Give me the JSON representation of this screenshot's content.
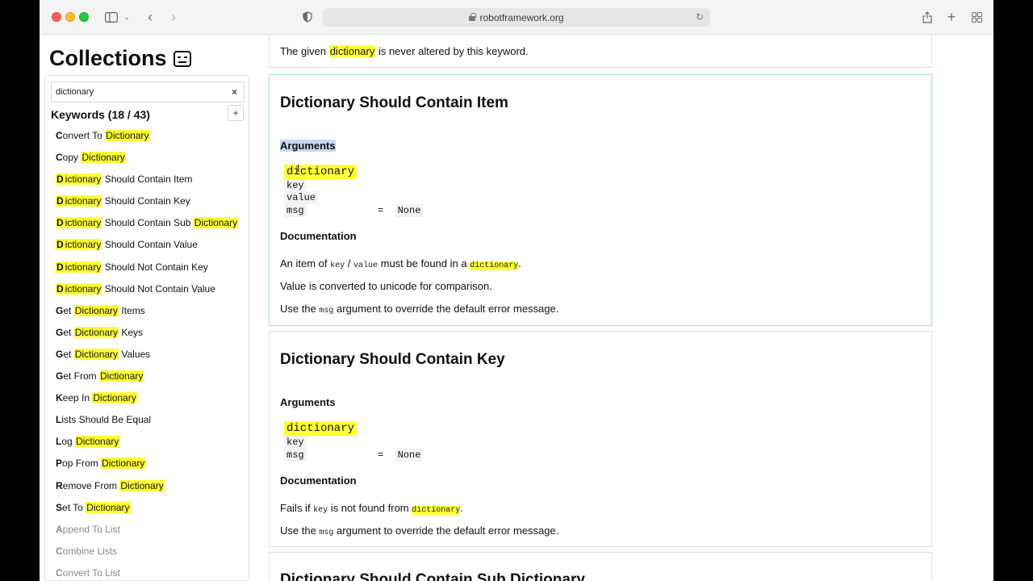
{
  "browser": {
    "url": "robotframework.org"
  },
  "sidebar": {
    "title": "Collections",
    "search_value": "dictionary",
    "clear_label": "×",
    "keywords_header": "Keywords (18 / 43)",
    "expand_label": "+",
    "items": [
      {
        "parts": [
          [
            "b",
            "C"
          ],
          [
            "t",
            "onvert To "
          ],
          [
            "m",
            "Dictionary"
          ]
        ]
      },
      {
        "parts": [
          [
            "b",
            "C"
          ],
          [
            "t",
            "opy "
          ],
          [
            "m",
            "Dictionary"
          ]
        ]
      },
      {
        "parts": [
          [
            "mb",
            "D"
          ],
          [
            "m",
            "ictionary"
          ],
          [
            "t",
            " Should Contain Item"
          ]
        ]
      },
      {
        "parts": [
          [
            "mb",
            "D"
          ],
          [
            "m",
            "ictionary"
          ],
          [
            "t",
            " Should Contain Key"
          ]
        ]
      },
      {
        "parts": [
          [
            "mb",
            "D"
          ],
          [
            "m",
            "ictionary"
          ],
          [
            "t",
            " Should Contain Sub "
          ],
          [
            "m",
            "Dictionary"
          ]
        ]
      },
      {
        "parts": [
          [
            "mb",
            "D"
          ],
          [
            "m",
            "ictionary"
          ],
          [
            "t",
            " Should Contain Value"
          ]
        ]
      },
      {
        "parts": [
          [
            "mb",
            "D"
          ],
          [
            "m",
            "ictionary"
          ],
          [
            "t",
            " Should Not Contain Key"
          ]
        ]
      },
      {
        "parts": [
          [
            "mb",
            "D"
          ],
          [
            "m",
            "ictionary"
          ],
          [
            "t",
            " Should Not Contain Value"
          ]
        ]
      },
      {
        "parts": [
          [
            "b",
            "G"
          ],
          [
            "t",
            "et "
          ],
          [
            "m",
            "Dictionary"
          ],
          [
            "t",
            " Items"
          ]
        ]
      },
      {
        "parts": [
          [
            "b",
            "G"
          ],
          [
            "t",
            "et "
          ],
          [
            "m",
            "Dictionary"
          ],
          [
            "t",
            " Keys"
          ]
        ]
      },
      {
        "parts": [
          [
            "b",
            "G"
          ],
          [
            "t",
            "et "
          ],
          [
            "m",
            "Dictionary"
          ],
          [
            "t",
            " Values"
          ]
        ]
      },
      {
        "parts": [
          [
            "b",
            "G"
          ],
          [
            "t",
            "et From "
          ],
          [
            "m",
            "Dictionary"
          ]
        ]
      },
      {
        "parts": [
          [
            "b",
            "K"
          ],
          [
            "t",
            "eep In "
          ],
          [
            "m",
            "Dictionary"
          ]
        ]
      },
      {
        "parts": [
          [
            "b",
            "L"
          ],
          [
            "t",
            "ists Should Be Equal"
          ]
        ]
      },
      {
        "parts": [
          [
            "b",
            "L"
          ],
          [
            "t",
            "og "
          ],
          [
            "m",
            "Dictionary"
          ]
        ]
      },
      {
        "parts": [
          [
            "b",
            "P"
          ],
          [
            "t",
            "op From "
          ],
          [
            "m",
            "Dictionary"
          ]
        ]
      },
      {
        "parts": [
          [
            "b",
            "R"
          ],
          [
            "t",
            "emove From "
          ],
          [
            "m",
            "Dictionary"
          ]
        ]
      },
      {
        "parts": [
          [
            "b",
            "S"
          ],
          [
            "t",
            "et To "
          ],
          [
            "m",
            "Dictionary"
          ]
        ]
      },
      {
        "dim": true,
        "parts": [
          [
            "b",
            "A"
          ],
          [
            "t",
            "ppend To List"
          ]
        ]
      },
      {
        "dim": true,
        "parts": [
          [
            "b",
            "C"
          ],
          [
            "t",
            "ombine Lists"
          ]
        ]
      },
      {
        "dim": true,
        "parts": [
          [
            "b",
            "C"
          ],
          [
            "t",
            "onvert To List"
          ]
        ]
      }
    ]
  },
  "main": {
    "top_note": {
      "pre": "The given ",
      "hl": "dictionary",
      "post": " is never altered by this keyword."
    },
    "card1": {
      "title": "Dictionary Should Contain Item",
      "args_label": "Arguments",
      "arg_dictionary": "dictionary",
      "arg_key": "key",
      "arg_value": "value",
      "arg_msg": "msg",
      "eq": "=",
      "default_none": "None",
      "doc_label": "Documentation",
      "doc1_pre": "An item of ",
      "doc1_key": "key",
      "doc1_sep": " / ",
      "doc1_value": "value",
      "doc1_mid": " must be found in a ",
      "doc1_dict": "dictionary",
      "doc1_end": ".",
      "doc2": "Value is converted to unicode for comparison.",
      "doc3_pre": "Use the ",
      "doc3_msg": "msg",
      "doc3_post": " argument to override the default error message."
    },
    "card2": {
      "title": "Dictionary Should Contain Key",
      "args_label": "Arguments",
      "arg_dictionary": "dictionary",
      "arg_key": "key",
      "arg_msg": "msg",
      "eq": "=",
      "default_none": "None",
      "doc_label": "Documentation",
      "doc1_pre": "Fails if ",
      "doc1_key": "key",
      "doc1_mid": " is not found from ",
      "doc1_dict": "dictionary",
      "doc1_end": ".",
      "doc2_pre": "Use the ",
      "doc2_msg": "msg",
      "doc2_post": " argument to override the default error message."
    },
    "card3": {
      "title": "Dictionary Should Contain Sub Dictionary"
    }
  }
}
